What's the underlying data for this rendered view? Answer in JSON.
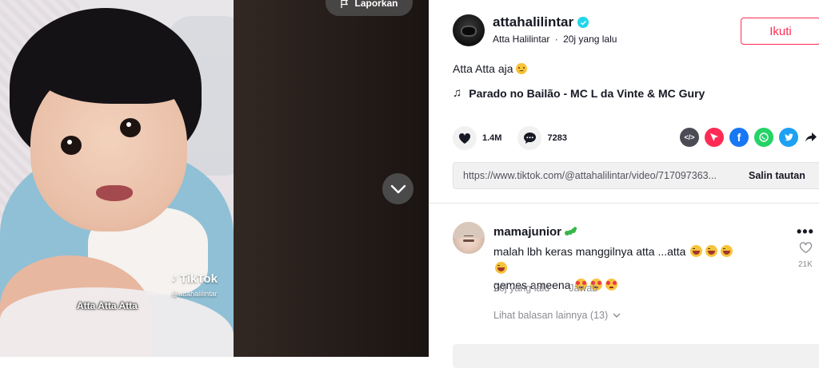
{
  "video": {
    "watermark_brand": "TikTok",
    "watermark_user": "@attahalilintar",
    "caption_overlay": "Atta Atta Atta",
    "report_label": "Laporkan"
  },
  "post": {
    "username": "attahalilintar",
    "display_name": "Atta Halilintar",
    "time_ago": "20j yang lalu",
    "follow_label": "Ikuti",
    "description": "Atta Atta aja",
    "music": "Parado no Bailão - MC L da Vinte & MC Gury",
    "likes": "1.4M",
    "comments": "7283",
    "share_link": "https://www.tiktok.com/@attahalilintar/video/717097363...",
    "copy_label": "Salin tautan"
  },
  "comment": {
    "username": "mamajunior",
    "text_line1": "malah lbh keras manggilnya atta ...atta",
    "text_line2": "gemes ameena",
    "time_ago": "20j yang lalu",
    "reply_label": "Jawab",
    "like_count": "21K",
    "more_replies": "Lihat balasan lainnya (13)"
  },
  "colors": {
    "accent": "#fe2c55",
    "verified": "#20d5ec"
  }
}
